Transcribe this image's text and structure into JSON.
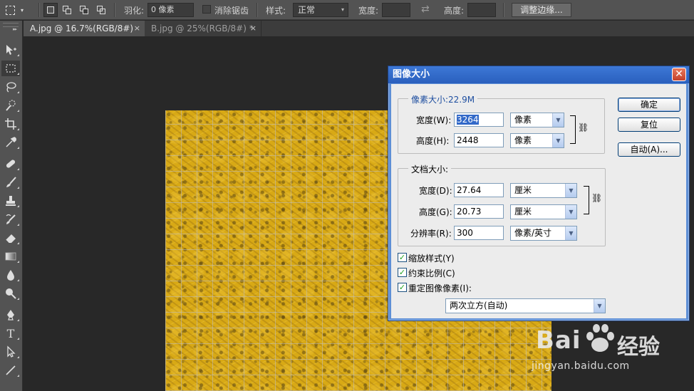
{
  "options_bar": {
    "feather_label": "羽化:",
    "feather_value": "0 像素",
    "antialias_label": "消除锯齿",
    "style_label": "样式:",
    "style_value": "正常",
    "width_label": "宽度:",
    "height_label": "高度:",
    "refine_edge_button": "调整边缘..."
  },
  "tabs": [
    {
      "label": "A.jpg @ 16.7%(RGB/8#)",
      "close": "×",
      "active": true
    },
    {
      "label": "B.jpg @ 25%(RGB/8#) *",
      "close": "×",
      "active": false
    }
  ],
  "tools": [
    "move-tool",
    "marquee-tool",
    "lasso-tool",
    "quick-select-tool",
    "crop-tool",
    "eyedropper-tool",
    "healing-brush-tool",
    "brush-tool",
    "clone-stamp-tool",
    "history-brush-tool",
    "eraser-tool",
    "gradient-tool",
    "blur-tool",
    "dodge-tool",
    "pen-tool",
    "type-tool",
    "path-select-tool",
    "line-tool"
  ],
  "tool_type_glyph": "T",
  "dialog": {
    "title": "图像大小",
    "close": "✕",
    "pixel_dims": {
      "title": "像素大小:22.9M",
      "width_label": "宽度(W):",
      "width_value": "3264",
      "width_unit": "像素",
      "height_label": "高度(H):",
      "height_value": "2448",
      "height_unit": "像素"
    },
    "doc_size": {
      "title": "文档大小:",
      "width_label": "宽度(D):",
      "width_value": "27.64",
      "width_unit": "厘米",
      "height_label": "高度(G):",
      "height_value": "20.73",
      "height_unit": "厘米",
      "resolution_label": "分辨率(R):",
      "resolution_value": "300",
      "resolution_unit": "像素/英寸"
    },
    "checkboxes": [
      {
        "label": "缩放样式(Y)",
        "checked": true
      },
      {
        "label": "约束比例(C)",
        "checked": true
      },
      {
        "label": "重定图像像素(I):",
        "checked": true
      }
    ],
    "resample_method": "两次立方(自动)",
    "buttons": {
      "ok": "确定",
      "reset": "复位",
      "auto": "自动(A)..."
    },
    "link_glyph": "⛓"
  },
  "watermark": {
    "logo": "Bai",
    "brand": "经验",
    "url": "jingyan.baidu.com"
  },
  "glyphs": {
    "dropdown_arrow": "▼",
    "swap": "⇄",
    "checkmark": "✓",
    "small_caret": "▾"
  }
}
